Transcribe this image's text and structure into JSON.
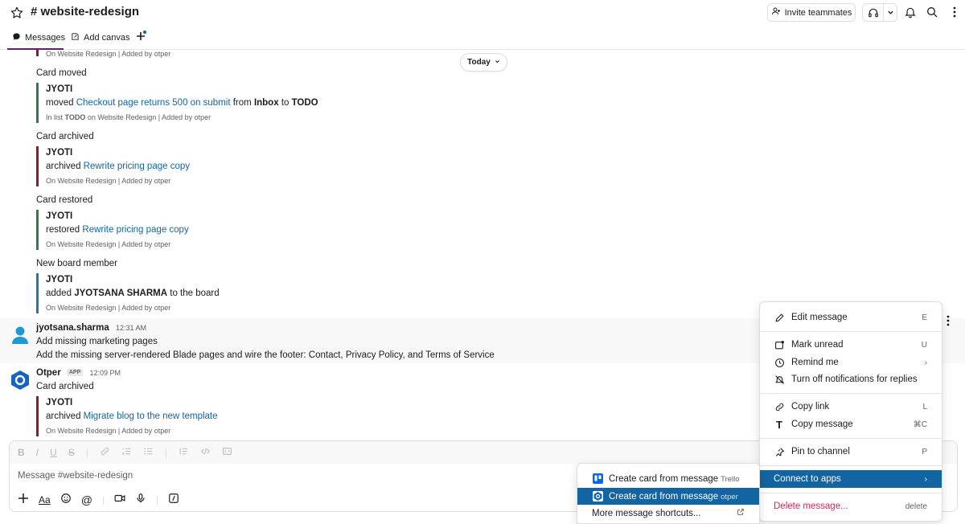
{
  "header": {
    "channel_title": "# website-redesign",
    "invite_label": "Invite teammates"
  },
  "tabs": [
    {
      "label": "Messages"
    },
    {
      "label": "Add canvas"
    }
  ],
  "today_label": "Today",
  "messages": {
    "top_meta": {
      "list": "On Website Redesign",
      "added": "Added by otper"
    },
    "m1": {
      "heading": "Card moved",
      "user": "JYOTI",
      "verb": "moved",
      "card": "Checkout page returns 500 on submit",
      "from_word": "from",
      "from_list": "Inbox",
      "to_word": "to",
      "to_list": "TODO",
      "meta_prefix": "In list",
      "meta_list": "TODO",
      "meta_board": "on Website Redesign",
      "added": "Added by otper"
    },
    "m2": {
      "heading": "Card archived",
      "user": "JYOTI",
      "verb": "archived",
      "card": "Rewrite pricing page copy",
      "meta": "On Website Redesign",
      "added": "Added by otper"
    },
    "m3": {
      "heading": "Card restored",
      "user": "JYOTI",
      "verb": "restored",
      "card": "Rewrite pricing page copy",
      "meta": "On Website Redesign",
      "added": "Added by otper"
    },
    "m4": {
      "heading": "New board member",
      "user": "JYOTI",
      "verb": "added",
      "member": "JYOTSANA SHARMA",
      "rest": "to the board",
      "meta": "On Website Redesign",
      "added": "Added by otper"
    },
    "m5": {
      "author": "jyotsana.sharma",
      "time": "12:31 AM",
      "line1": "Add missing marketing pages",
      "line2": "Add the missing server-rendered Blade pages and wire the footer: Contact, Privacy Policy, and Terms of Service"
    },
    "m6": {
      "author": "Otper",
      "badge": "APP",
      "time": "12:09 PM",
      "heading": "Card archived",
      "user": "JYOTI",
      "verb": "archived",
      "card": "Migrate blog to the new template",
      "meta": "On Website Redesign",
      "added": "Added by otper"
    }
  },
  "composer": {
    "placeholder": "Message #website-redesign"
  },
  "menu": {
    "edit": {
      "label": "Edit message",
      "shortcut": "E"
    },
    "mark_unread": {
      "label": "Mark unread",
      "shortcut": "U"
    },
    "remind": {
      "label": "Remind me",
      "shortcut": "›"
    },
    "notif": {
      "label": "Turn off notifications for replies"
    },
    "copy_link": {
      "label": "Copy link",
      "shortcut": "L"
    },
    "copy_message": {
      "label": "Copy message",
      "shortcut": "⌘C"
    },
    "pin": {
      "label": "Pin to channel",
      "shortcut": "P"
    },
    "connect": {
      "label": "Connect to apps",
      "shortcut": "›"
    },
    "delete": {
      "label": "Delete message...",
      "shortcut": "delete"
    }
  },
  "submenu": {
    "trello": {
      "label": "Create card from message",
      "app": "Trello"
    },
    "otper": {
      "label": "Create card from message",
      "app": "otper"
    },
    "more": {
      "label": "More message shortcuts..."
    }
  },
  "colors": {
    "accent": "#1264a3",
    "bar_red": "#8b1a2b",
    "bar_green": "#2e7d4f",
    "bar_blue": "#1f7aa8",
    "danger": "#e01e5a"
  }
}
